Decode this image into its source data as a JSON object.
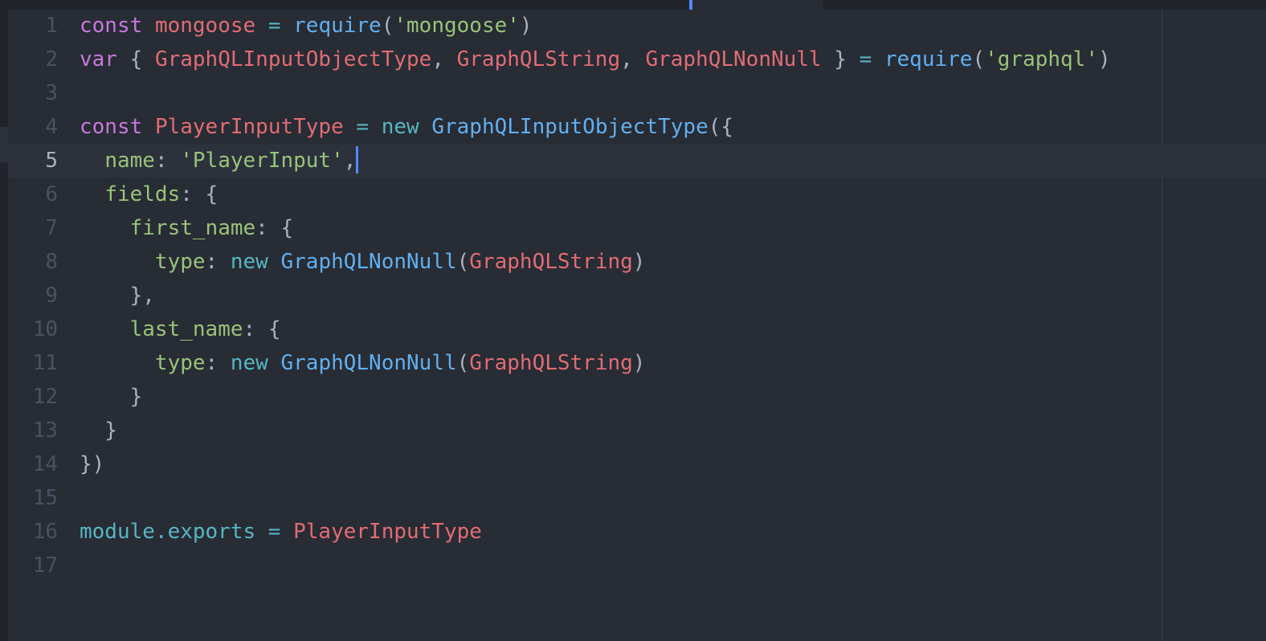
{
  "editor": {
    "language": "javascript",
    "active_line": 5,
    "colors": {
      "background": "#282c34",
      "keyword": "#c678dd",
      "variable": "#e06c75",
      "function": "#61afef",
      "string": "#98c379",
      "operator": "#56b6c2",
      "punctuation": "#abb2bf",
      "line_number": "#495162",
      "cursor": "#528bff"
    },
    "lines": [
      {
        "number": "1",
        "tokens": [
          {
            "text": "const",
            "color": "#c678dd"
          },
          {
            "text": " ",
            "color": "#abb2bf"
          },
          {
            "text": "mongoose",
            "color": "#e06c75"
          },
          {
            "text": " = ",
            "color": "#56b6c2"
          },
          {
            "text": "require",
            "color": "#61afef"
          },
          {
            "text": "(",
            "color": "#abb2bf"
          },
          {
            "text": "'mongoose'",
            "color": "#98c379"
          },
          {
            "text": ")",
            "color": "#abb2bf"
          }
        ]
      },
      {
        "number": "2",
        "tokens": [
          {
            "text": "var",
            "color": "#c678dd"
          },
          {
            "text": " { ",
            "color": "#abb2bf"
          },
          {
            "text": "GraphQLInputObjectType",
            "color": "#e06c75"
          },
          {
            "text": ", ",
            "color": "#abb2bf"
          },
          {
            "text": "GraphQLString",
            "color": "#e06c75"
          },
          {
            "text": ", ",
            "color": "#abb2bf"
          },
          {
            "text": "GraphQLNonNull",
            "color": "#e06c75"
          },
          {
            "text": " } ",
            "color": "#abb2bf"
          },
          {
            "text": "= ",
            "color": "#56b6c2"
          },
          {
            "text": "require",
            "color": "#61afef"
          },
          {
            "text": "(",
            "color": "#abb2bf"
          },
          {
            "text": "'graphql'",
            "color": "#98c379"
          },
          {
            "text": ")",
            "color": "#abb2bf"
          }
        ]
      },
      {
        "number": "3",
        "tokens": []
      },
      {
        "number": "4",
        "tokens": [
          {
            "text": "const",
            "color": "#c678dd"
          },
          {
            "text": " ",
            "color": "#abb2bf"
          },
          {
            "text": "PlayerInputType",
            "color": "#e06c75"
          },
          {
            "text": " = ",
            "color": "#56b6c2"
          },
          {
            "text": "new",
            "color": "#56b6c2"
          },
          {
            "text": " ",
            "color": "#abb2bf"
          },
          {
            "text": "GraphQLInputObjectType",
            "color": "#61afef"
          },
          {
            "text": "({",
            "color": "#abb2bf"
          }
        ]
      },
      {
        "number": "5",
        "tokens": [
          {
            "text": "  ",
            "color": "#abb2bf"
          },
          {
            "text": "name",
            "color": "#98c379"
          },
          {
            "text": ": ",
            "color": "#abb2bf"
          },
          {
            "text": "'PlayerInput'",
            "color": "#98c379"
          },
          {
            "text": ",",
            "color": "#abb2bf"
          }
        ]
      },
      {
        "number": "6",
        "tokens": [
          {
            "text": "  ",
            "color": "#abb2bf"
          },
          {
            "text": "fields",
            "color": "#98c379"
          },
          {
            "text": ": {",
            "color": "#abb2bf"
          }
        ]
      },
      {
        "number": "7",
        "tokens": [
          {
            "text": "    ",
            "color": "#abb2bf"
          },
          {
            "text": "first_name",
            "color": "#98c379"
          },
          {
            "text": ": {",
            "color": "#abb2bf"
          }
        ]
      },
      {
        "number": "8",
        "tokens": [
          {
            "text": "      ",
            "color": "#abb2bf"
          },
          {
            "text": "type",
            "color": "#98c379"
          },
          {
            "text": ": ",
            "color": "#abb2bf"
          },
          {
            "text": "new",
            "color": "#56b6c2"
          },
          {
            "text": " ",
            "color": "#abb2bf"
          },
          {
            "text": "GraphQLNonNull",
            "color": "#61afef"
          },
          {
            "text": "(",
            "color": "#abb2bf"
          },
          {
            "text": "GraphQLString",
            "color": "#e06c75"
          },
          {
            "text": ")",
            "color": "#abb2bf"
          }
        ]
      },
      {
        "number": "9",
        "tokens": [
          {
            "text": "    },",
            "color": "#abb2bf"
          }
        ]
      },
      {
        "number": "10",
        "tokens": [
          {
            "text": "    ",
            "color": "#abb2bf"
          },
          {
            "text": "last_name",
            "color": "#98c379"
          },
          {
            "text": ": {",
            "color": "#abb2bf"
          }
        ]
      },
      {
        "number": "11",
        "tokens": [
          {
            "text": "      ",
            "color": "#abb2bf"
          },
          {
            "text": "type",
            "color": "#98c379"
          },
          {
            "text": ": ",
            "color": "#abb2bf"
          },
          {
            "text": "new",
            "color": "#56b6c2"
          },
          {
            "text": " ",
            "color": "#abb2bf"
          },
          {
            "text": "GraphQLNonNull",
            "color": "#61afef"
          },
          {
            "text": "(",
            "color": "#abb2bf"
          },
          {
            "text": "GraphQLString",
            "color": "#e06c75"
          },
          {
            "text": ")",
            "color": "#abb2bf"
          }
        ]
      },
      {
        "number": "12",
        "tokens": [
          {
            "text": "    }",
            "color": "#abb2bf"
          }
        ]
      },
      {
        "number": "13",
        "tokens": [
          {
            "text": "  }",
            "color": "#abb2bf"
          }
        ]
      },
      {
        "number": "14",
        "tokens": [
          {
            "text": "})",
            "color": "#abb2bf"
          }
        ]
      },
      {
        "number": "15",
        "tokens": []
      },
      {
        "number": "16",
        "tokens": [
          {
            "text": "module.exports",
            "color": "#56b6c2"
          },
          {
            "text": " = ",
            "color": "#56b6c2"
          },
          {
            "text": "PlayerInputType",
            "color": "#e06c75"
          }
        ]
      },
      {
        "number": "17",
        "tokens": []
      }
    ]
  }
}
